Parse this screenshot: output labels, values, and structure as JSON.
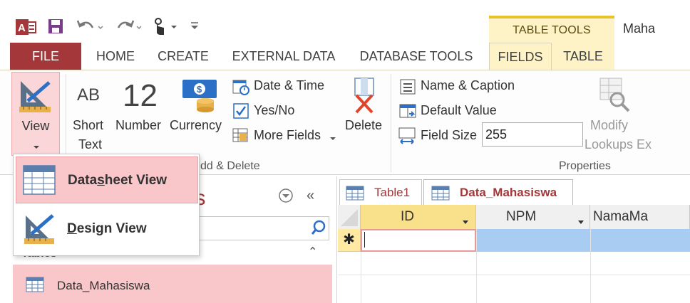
{
  "app": {
    "title": "Maha",
    "contextual_group": "TABLE TOOLS",
    "icons": [
      "access-logo-icon",
      "save-icon",
      "undo-icon",
      "redo-icon",
      "touch-mode-icon",
      "customize-qat-icon"
    ]
  },
  "tabs": {
    "file": "FILE",
    "home": "HOME",
    "create": "CREATE",
    "external_data": "EXTERNAL DATA",
    "database_tools": "DATABASE TOOLS",
    "fields": "FIELDS",
    "table": "TABLE"
  },
  "ribbon": {
    "view": "View",
    "short_text_icon": "AB",
    "short_text_1": "Short",
    "short_text_2": "Text",
    "number_icon": "12",
    "number": "Number",
    "currency": "Currency",
    "date_time": "Date & Time",
    "yes_no": "Yes/No",
    "more_fields": "More Fields",
    "delete": "Delete",
    "group_add_delete": "dd & Delete",
    "name_caption": "Name & Caption",
    "default_value": "Default Value",
    "field_size": "Field Size",
    "field_size_value": "255",
    "modify_1": "Modify",
    "modify_2": "Lookups Ex",
    "group_properties": "Properties"
  },
  "view_menu": {
    "datasheet_pre": "Data",
    "datasheet_key": "s",
    "datasheet_post": "heet View",
    "design_key": "D",
    "design_post": "esign View"
  },
  "nav": {
    "title_partial": "cts",
    "tables_header": "Tables",
    "item": "Data_Mahasiswa"
  },
  "document": {
    "tab1": "Table1",
    "tab2": "Data_Mahasiswa",
    "columns": [
      "ID",
      "NPM",
      "NamaMa"
    ],
    "new_row_marker": "✱"
  },
  "colors": {
    "access_red": "#a4373a",
    "context_yellow": "#fdf3c7",
    "selection_pink": "#f9c6c9",
    "row_blue": "#a9cdf2"
  }
}
